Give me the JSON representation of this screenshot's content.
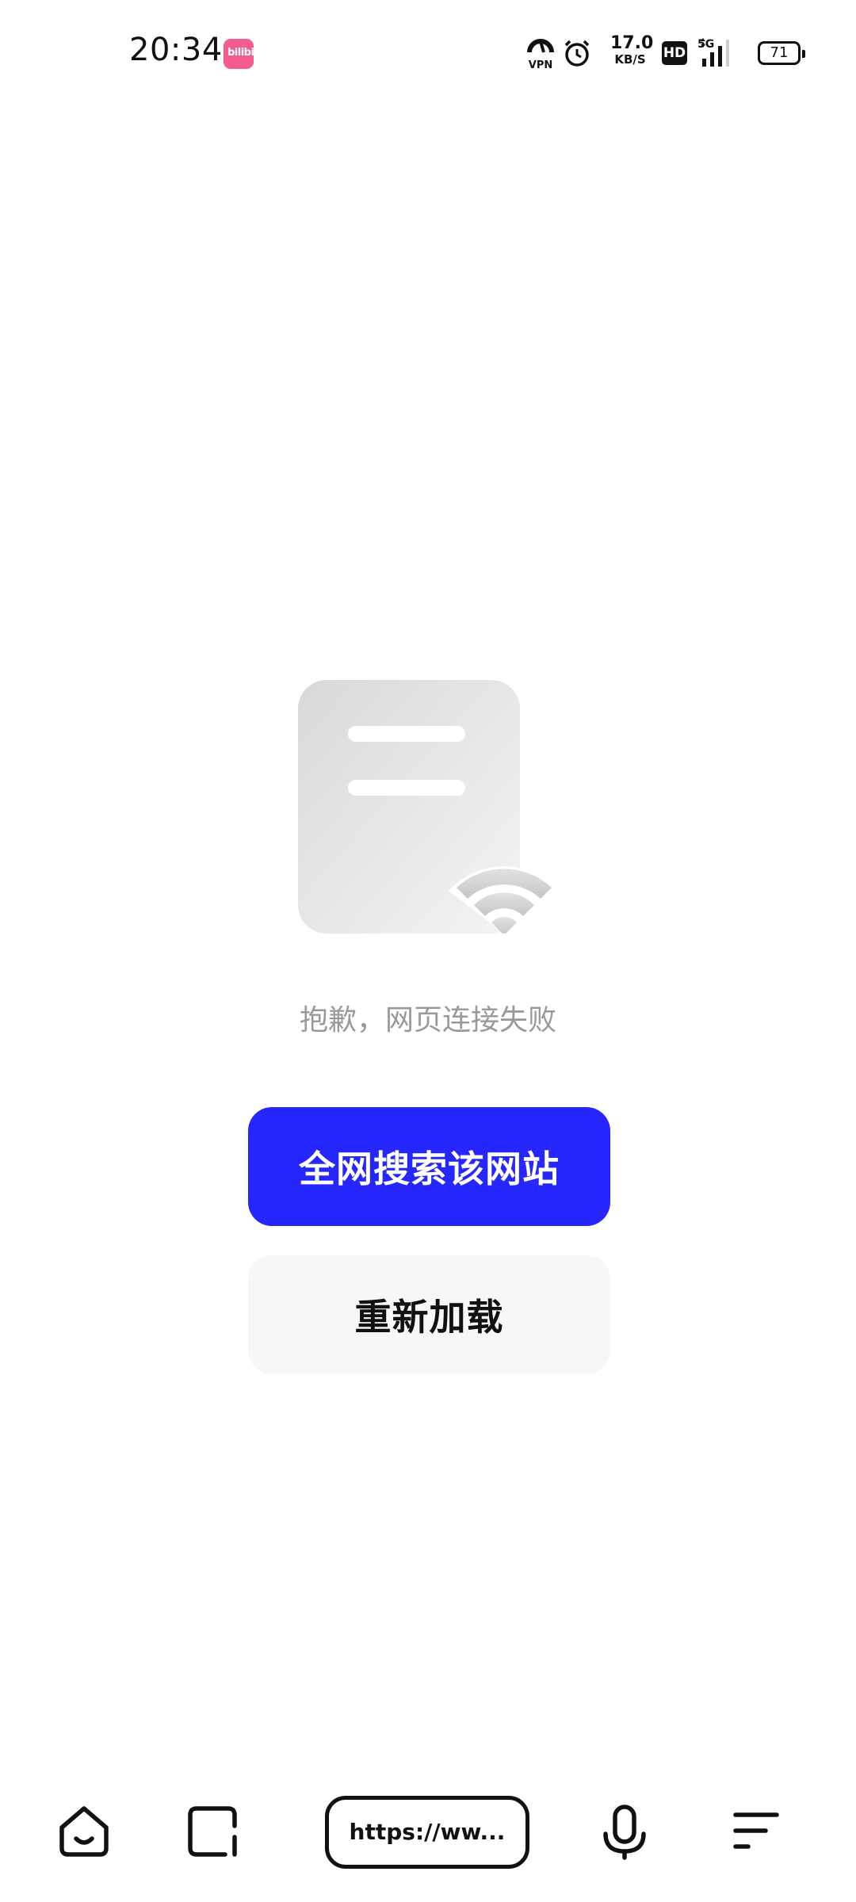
{
  "status_bar": {
    "time": "20:34",
    "app_badge_text": "bilibili",
    "vpn_label": "VPN",
    "net_speed_value": "17.0",
    "net_speed_unit": "KB/S",
    "hd_label": "HD",
    "network_type": "5G",
    "battery_level": "71"
  },
  "error": {
    "message": "抱歉，网页连接失败"
  },
  "actions": {
    "search_web_label": "全网搜索该网站",
    "reload_label": "重新加载"
  },
  "toolbar": {
    "url_text": "https://ww..."
  },
  "colors": {
    "primary": "#2626ff",
    "secondary_bg": "#f7f7f7",
    "message_text": "#999999",
    "badge": "#f25d8e"
  }
}
